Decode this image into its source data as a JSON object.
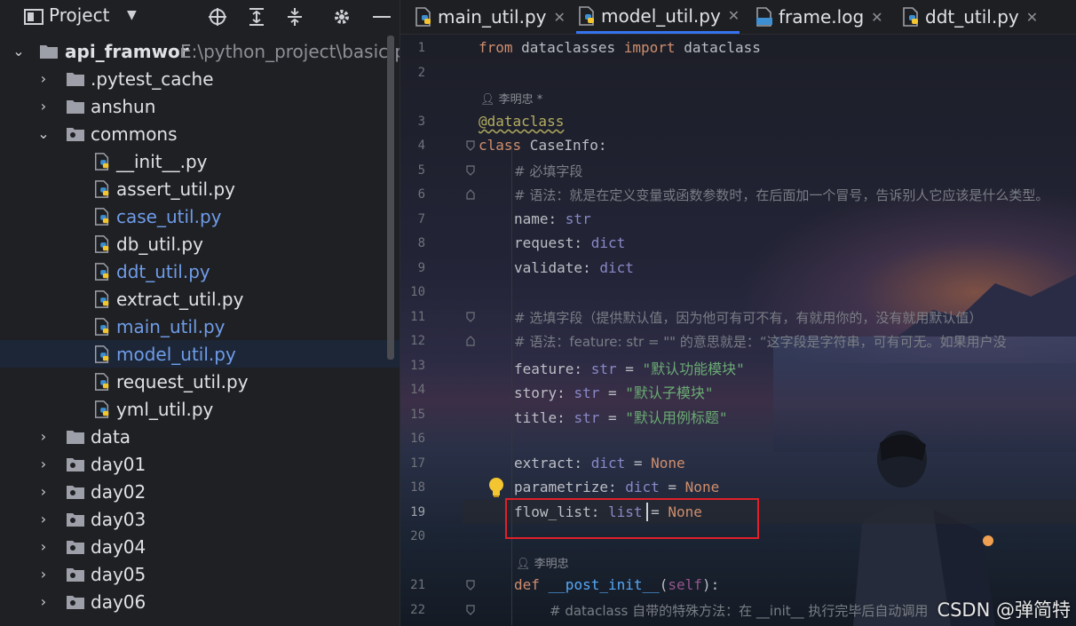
{
  "project_panel": {
    "title": "Project",
    "header_icons": [
      "crosshair-icon",
      "expand-all-icon",
      "collapse-all-icon",
      "gear-icon",
      "minimize-icon"
    ],
    "tree": [
      {
        "label": "api_framwor",
        "path": "E:\\python_project\\basic-p",
        "type": "root",
        "expanded": true
      },
      {
        "label": ".pytest_cache",
        "type": "folder",
        "expanded": false
      },
      {
        "label": "anshun",
        "type": "folder",
        "expanded": false
      },
      {
        "label": "commons",
        "type": "package",
        "expanded": true
      },
      {
        "label": "__init__.py",
        "type": "py"
      },
      {
        "label": "assert_util.py",
        "type": "py"
      },
      {
        "label": "case_util.py",
        "type": "py",
        "modified": true
      },
      {
        "label": "db_util.py",
        "type": "py"
      },
      {
        "label": "ddt_util.py",
        "type": "py",
        "modified": true
      },
      {
        "label": "extract_util.py",
        "type": "py"
      },
      {
        "label": "main_util.py",
        "type": "py",
        "modified": true
      },
      {
        "label": "model_util.py",
        "type": "py",
        "modified": true,
        "selected": true
      },
      {
        "label": "request_util.py",
        "type": "py"
      },
      {
        "label": "yml_util.py",
        "type": "py"
      },
      {
        "label": "data",
        "type": "folder",
        "expanded": false
      },
      {
        "label": "day01",
        "type": "package",
        "expanded": false
      },
      {
        "label": "day02",
        "type": "package",
        "expanded": false
      },
      {
        "label": "day03",
        "type": "package",
        "expanded": false
      },
      {
        "label": "day04",
        "type": "package",
        "expanded": false
      },
      {
        "label": "day05",
        "type": "package",
        "expanded": false
      },
      {
        "label": "day06",
        "type": "package",
        "expanded": false
      }
    ]
  },
  "tabs": [
    {
      "label": "main_util.py",
      "icon": "python-file-icon",
      "active": false
    },
    {
      "label": "model_util.py",
      "icon": "python-file-icon",
      "active": true
    },
    {
      "label": "frame.log",
      "icon": "log-file-icon",
      "active": false
    },
    {
      "label": "ddt_util.py",
      "icon": "python-file-icon",
      "active": false
    }
  ],
  "editor": {
    "author_hints": [
      "李明忠 *",
      "李明忠"
    ],
    "current_line": 19,
    "line_numbers": [
      "1",
      "2",
      "3",
      "4",
      "5",
      "6",
      "7",
      "8",
      "9",
      "10",
      "11",
      "12",
      "13",
      "14",
      "15",
      "16",
      "17",
      "18",
      "19",
      "20",
      "21",
      "22"
    ],
    "code": {
      "l1_from": "from",
      "l1_mod": " dataclasses ",
      "l1_import": "import",
      "l1_name": " dataclass",
      "l3_deco": "@dataclass",
      "l4_class": "class",
      "l4_name": " CaseInfo:",
      "l5": "# 必填字段",
      "l6": "# 语法：就是在定义变量或函数参数时，在后面加一个冒号，告诉别人它应该是什么类型。",
      "l7_name": "name: ",
      "l7_type": "str",
      "l8_name": "request: ",
      "l8_type": "dict",
      "l9_name": "validate: ",
      "l9_type": "dict",
      "l11": "# 选填字段（提供默认值，因为他可有可不有，有就用你的，没有就用默认值）",
      "l12_a": "# 语法：feature: str = \"\" 的意思就是：“这字段是字符串，可有可无。如果用户没",
      "l13_name": "feature: ",
      "l13_type": "str",
      "l13_eq": " = ",
      "l13_val": "\"默认功能模块\"",
      "l14_name": "story: ",
      "l14_type": "str",
      "l14_eq": " = ",
      "l14_val": "\"默认子模块\"",
      "l15_name": "title: ",
      "l15_type": "str",
      "l15_eq": " = ",
      "l15_val": "\"默认用例标题\"",
      "l17_name": "extract: ",
      "l17_type": "dict",
      "l17_eq": " = ",
      "l17_val": "None",
      "l18_name": "parametrize: ",
      "l18_type": "dict",
      "l18_eq": " = ",
      "l18_val": "None",
      "l19_name": "flow_list: ",
      "l19_type": "list",
      "l19_eq": " = ",
      "l19_val": "None",
      "l21_def": "def",
      "l21_fn": " __post_init__",
      "l21_p1": "(",
      "l21_self": "self",
      "l21_p2": "):",
      "l22": "# dataclass 自带的特殊方法：在 __init__ 执行完毕后自动调用"
    }
  },
  "watermark": "CSDN @弹简特",
  "colors": {
    "accent": "#3574f0",
    "keyword": "#cf8e6d",
    "string": "#6aab73",
    "comment": "#7a7e85",
    "builtin_type": "#8888c6",
    "highlight_box": "#e0202a",
    "vcs_modified": "#6f9ce8"
  }
}
